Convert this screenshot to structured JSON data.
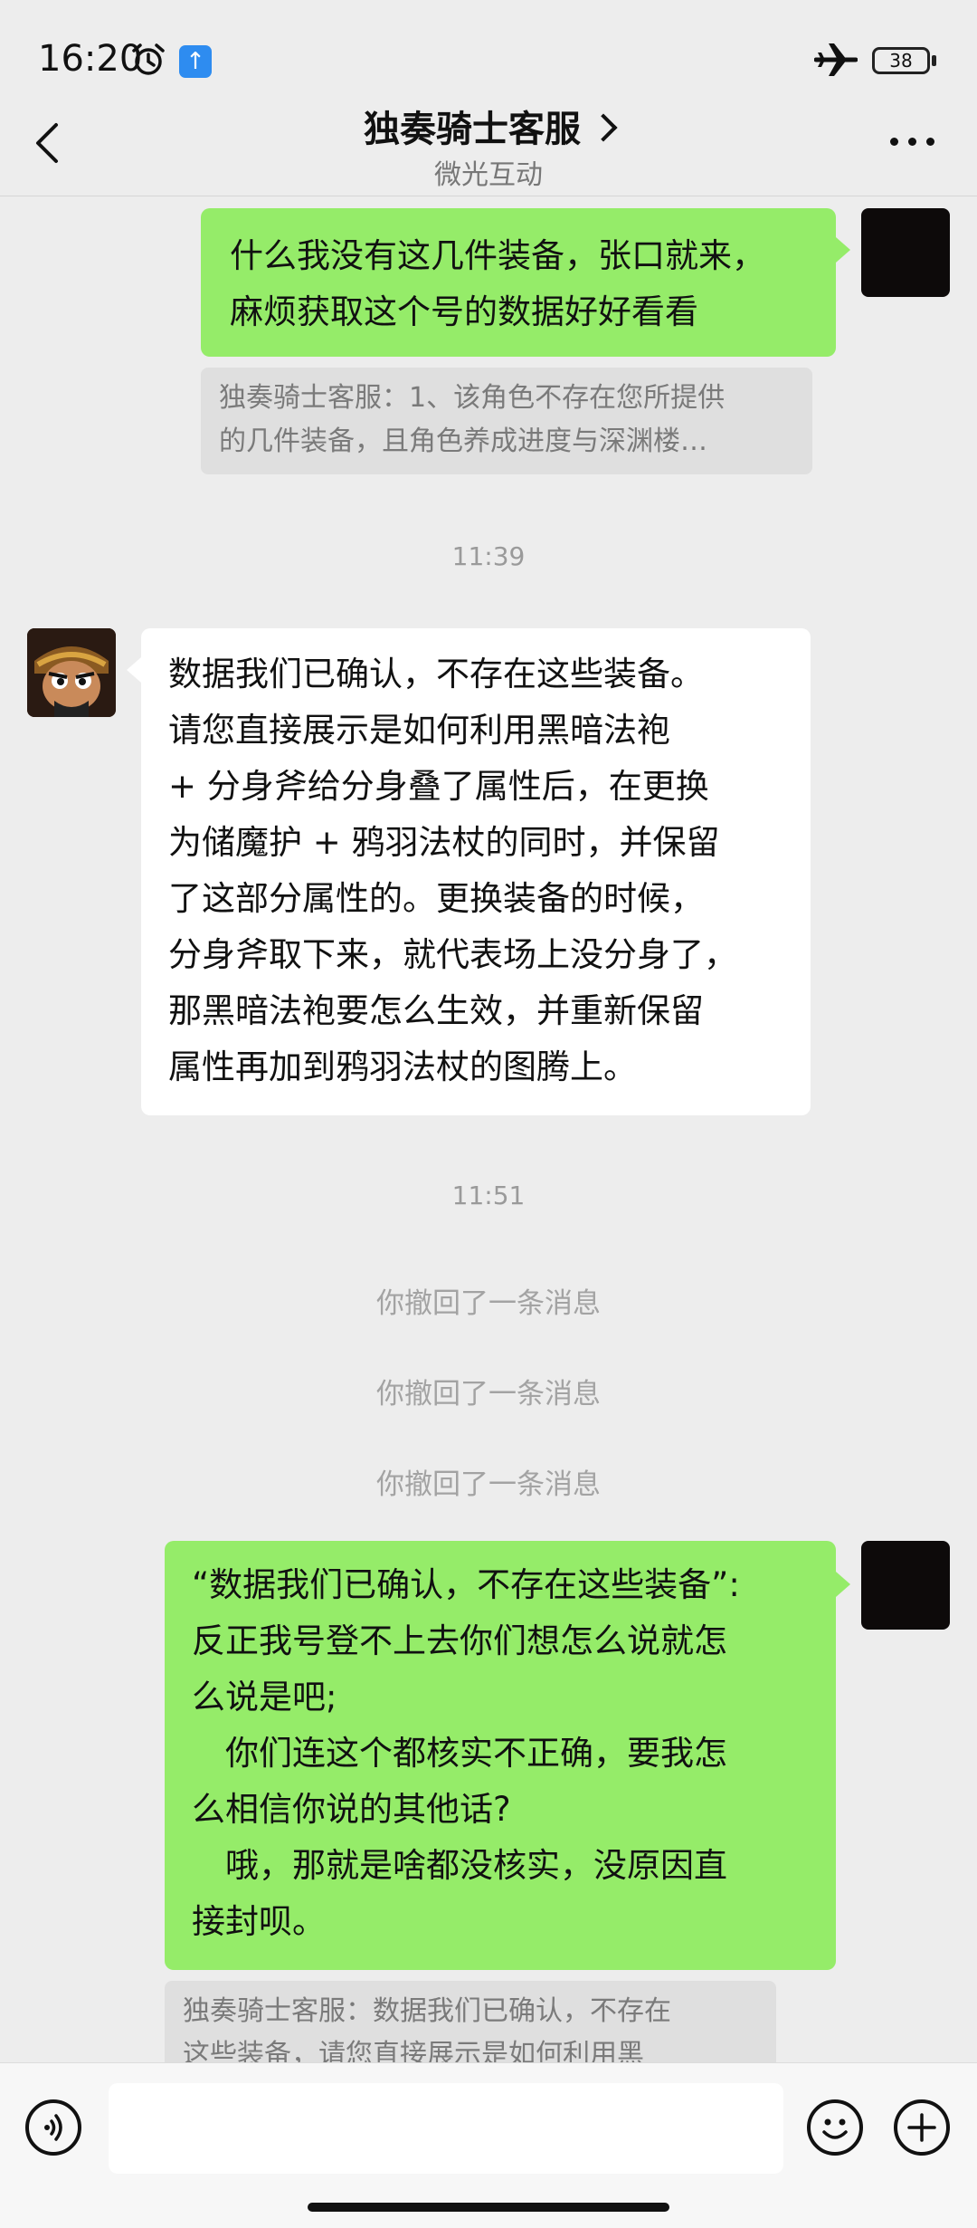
{
  "status_bar": {
    "time": "16:20",
    "battery": "38",
    "icons": [
      "alarm-icon",
      "upload-icon",
      "airplane-mode-icon",
      "battery-icon"
    ]
  },
  "header": {
    "title": "独奏骑士客服",
    "subtitle": "微光互动",
    "icons": [
      "back-arrow-icon",
      "chevron-right-icon",
      "more-icon"
    ]
  },
  "chat": {
    "msg1": {
      "lines": [
        "什么我没有这几件装备，张口就来，",
        "麻烦获取这个号的数据好好看看"
      ]
    },
    "quote1": {
      "lines": [
        "独奏骑士客服：1、该角色不存在您所提供",
        "的几件装备，且角色养成进度与深渊楼…"
      ]
    },
    "time1": "11:39",
    "msg2": {
      "lines": [
        "数据我们已确认，不存在这些装备。",
        "请您直接展示是如何利用黑暗法袍",
        "+ 分身斧给分身叠了属性后，在更换",
        "为储魔护 + 鸦羽法杖的同时，并保留",
        "了这部分属性的。更换装备的时候，",
        "分身斧取下来，就代表场上没分身了，",
        "那黑暗法袍要怎么生效，并重新保留",
        "属性再加到鸦羽法杖的图腾上。"
      ]
    },
    "time2": "11:51",
    "recalls": [
      "你撤回了一条消息",
      "你撤回了一条消息",
      "你撤回了一条消息"
    ],
    "msg3": {
      "lines": [
        "“数据我们已确认，不存在这些装备”:",
        "反正我号登不上去你们想怎么说就怎",
        "么说是吧;",
        "　你们连这个都核实不正确，要我怎",
        "么相信你说的其他话?",
        "　哦，那就是啥都没核实，没原因直",
        "接封呗。"
      ]
    },
    "quote2": {
      "lines": [
        "独奏骑士客服：数据我们已确认，不存在",
        "这些装备，请您直接展示是如何利用黑"
      ]
    }
  },
  "input_bar": {
    "value": "",
    "icons": [
      "voice-icon",
      "emoji-icon",
      "add-icon"
    ]
  },
  "colors": {
    "sent_bubble": "#95ec69",
    "received_bubble": "#ffffff",
    "background": "#ededed"
  }
}
